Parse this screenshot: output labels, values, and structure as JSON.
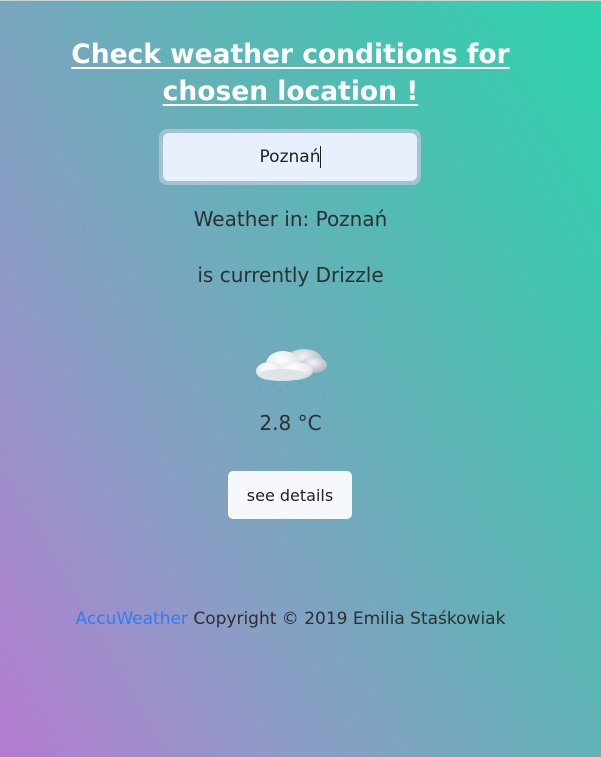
{
  "header": {
    "title": "Check weather conditions for chosen location !"
  },
  "search": {
    "value": "Poznań",
    "placeholder": ""
  },
  "result": {
    "weather_in_label": "Weather in: Poznań",
    "condition_text": "is currently Drizzle",
    "icon": "drizzle-cloud-icon",
    "temperature": "2.8 °C"
  },
  "actions": {
    "details_label": "see details"
  },
  "footer": {
    "link_label": "AccuWeather",
    "copyright_text": " Copyright © 2019 Emilia Staśkowiak"
  },
  "colors": {
    "gradient_start": "#b57bd0",
    "gradient_end": "#2fd4ae",
    "title": "#ffffff",
    "link": "#2f7df0",
    "input_bg": "#e8f0fd"
  }
}
